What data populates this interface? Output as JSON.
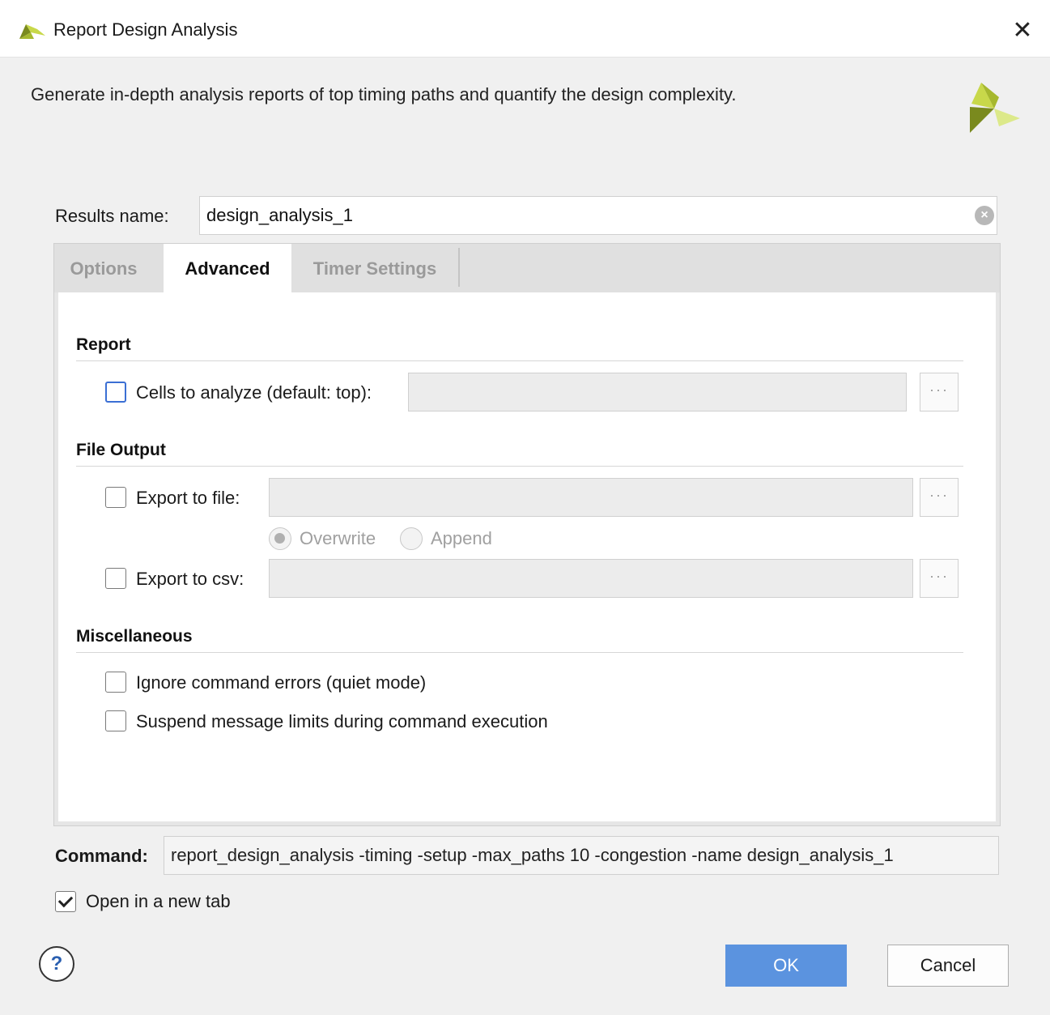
{
  "window": {
    "title": "Report Design Analysis",
    "close_glyph": "✕"
  },
  "description": "Generate in-depth analysis reports of top timing paths and quantify the design complexity.",
  "results": {
    "label": "Results name:",
    "value": "design_analysis_1"
  },
  "tabs": [
    {
      "label": "Options",
      "active": false
    },
    {
      "label": "Advanced",
      "active": true
    },
    {
      "label": "Timer Settings",
      "active": false
    }
  ],
  "report": {
    "title": "Report",
    "cells_label": "Cells to analyze (default: top):",
    "cells_checked": false
  },
  "file_output": {
    "title": "File Output",
    "export_file_label": "Export to file:",
    "export_file_checked": false,
    "overwrite_label": "Overwrite",
    "append_label": "Append",
    "selected_mode": "Overwrite",
    "export_csv_label": "Export to csv:",
    "export_csv_checked": false,
    "browse_glyph": "···"
  },
  "misc": {
    "title": "Miscellaneous",
    "quiet_label": "Ignore command errors (quiet mode)",
    "quiet_checked": false,
    "suspend_label": "Suspend message limits during command execution",
    "suspend_checked": false
  },
  "command": {
    "label": "Command:",
    "value": "report_design_analysis -timing -setup -max_paths 10 -congestion -name design_analysis_1"
  },
  "open_new_tab": {
    "label": "Open in a new tab",
    "checked": true
  },
  "footer": {
    "help_glyph": "?",
    "ok_label": "OK",
    "cancel_label": "Cancel"
  },
  "colors": {
    "ok_button": "#5b93df",
    "logo_dark": "#7a8a1e",
    "logo_light": "#c8d84a",
    "focus_blue": "#3b6fd4"
  }
}
